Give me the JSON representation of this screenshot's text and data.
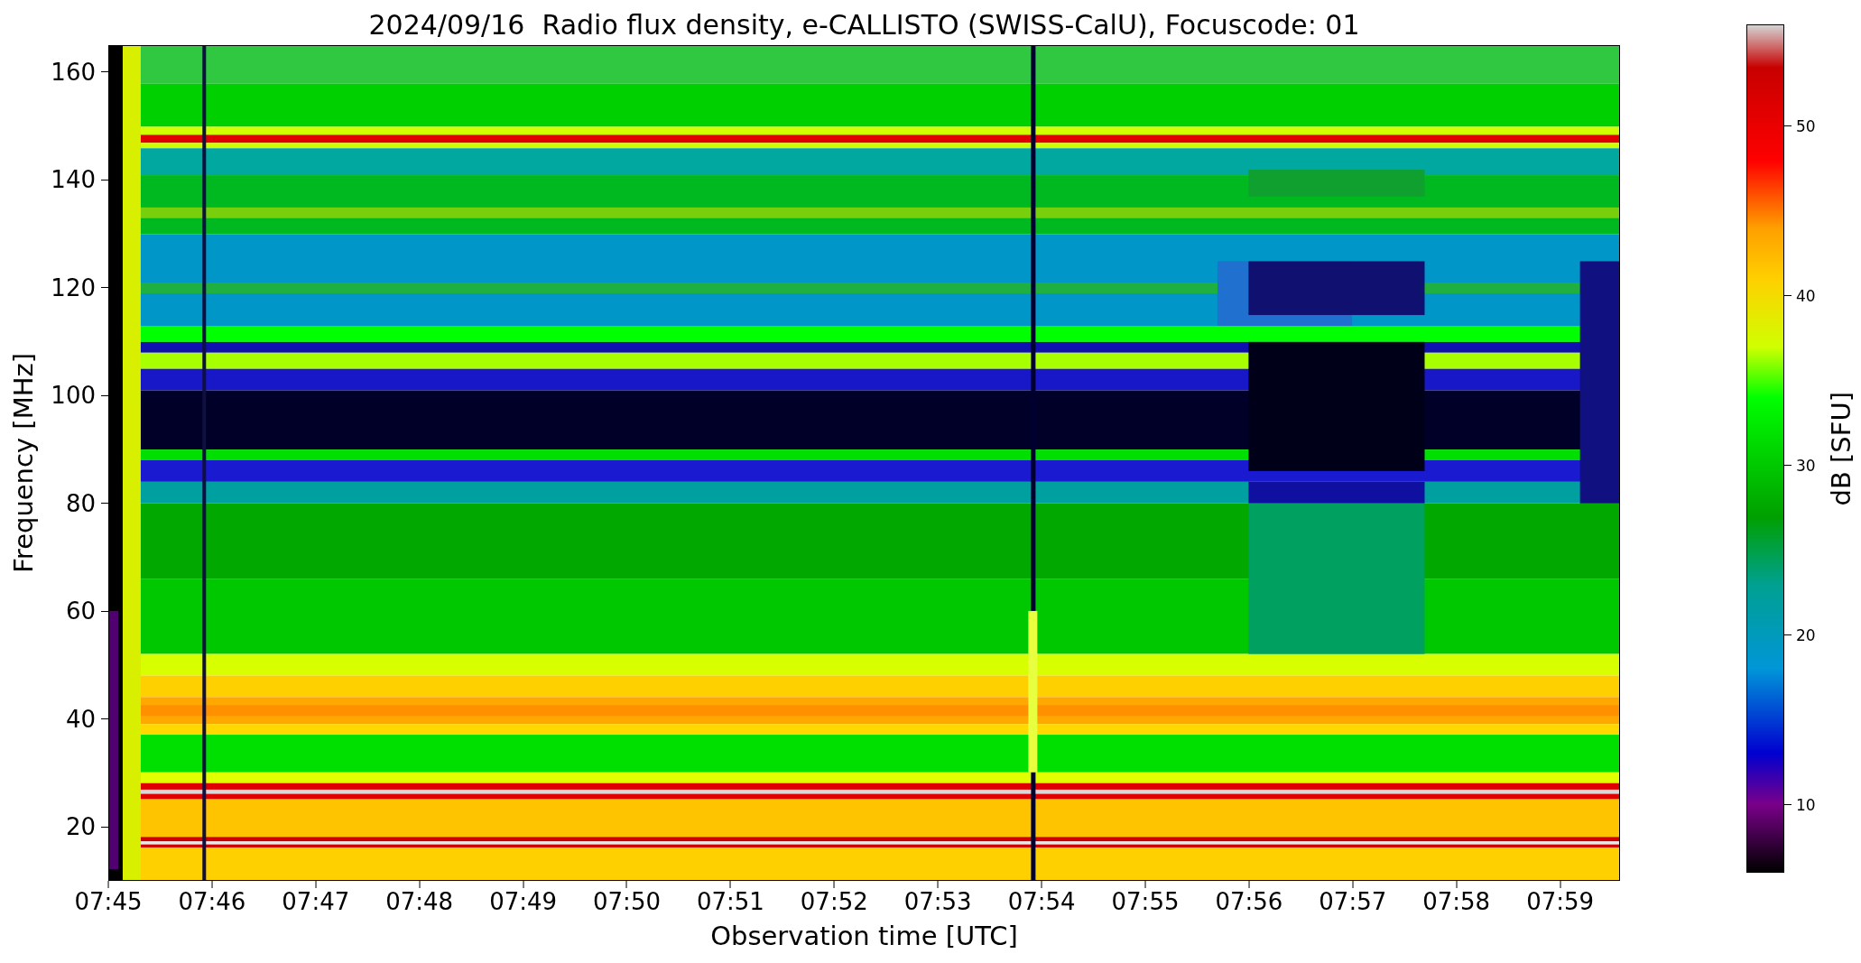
{
  "title": "2024/09/16  Radio flux density, e-CALLISTO (SWISS-CalU), Focuscode: 01",
  "plot": {
    "ylabel": "Frequency [MHz]",
    "xlabel": "Observation time [UTC]",
    "yticks": [
      "160",
      "140",
      "120",
      "100",
      "80",
      "60",
      "40",
      "20"
    ],
    "xticks": [
      "07:45",
      "07:46",
      "07:47",
      "07:48",
      "07:49",
      "07:50",
      "07:51",
      "07:52",
      "07:53",
      "07:54",
      "07:55",
      "07:56",
      "07:57",
      "07:58",
      "07:59"
    ]
  },
  "colorbar": {
    "label": "dB [SFU]",
    "ticks": [
      "50",
      "40",
      "30",
      "20",
      "10"
    ]
  }
}
